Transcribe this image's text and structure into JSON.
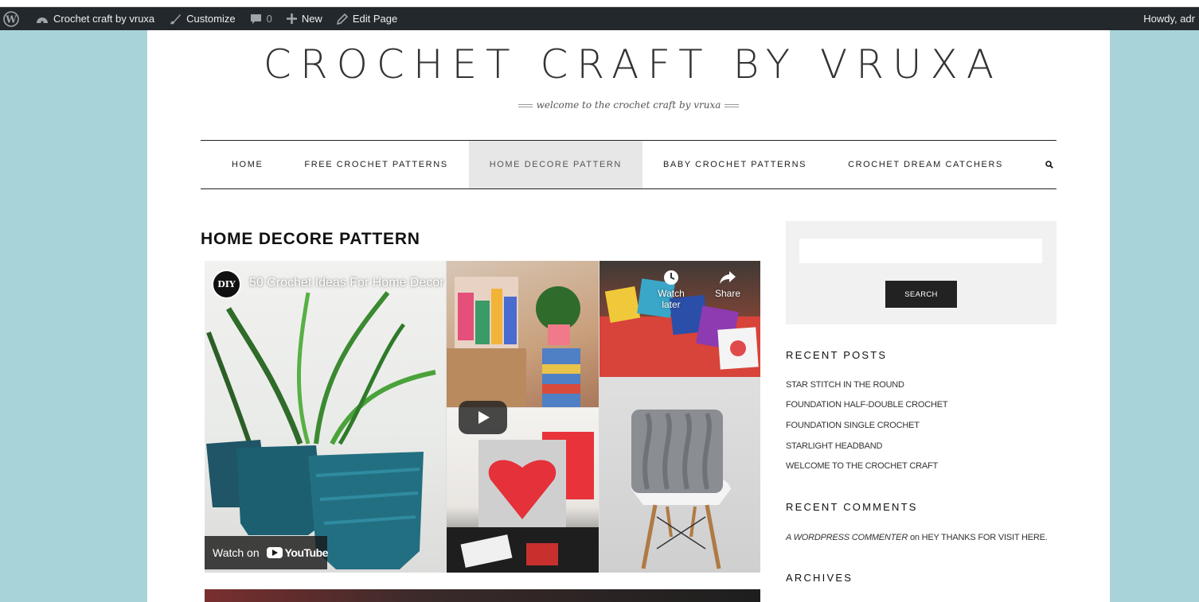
{
  "admin_bar": {
    "site_name": "Crochet craft by vruxa",
    "customize": "Customize",
    "comments_count": "0",
    "new": "New",
    "edit_page": "Edit Page",
    "howdy": "Howdy, adr"
  },
  "site": {
    "title": "CROCHET CRAFT BY VRUXA",
    "tagline": "welcome to the crochet craft by vruxa"
  },
  "nav": {
    "items": [
      {
        "label": "HOME"
      },
      {
        "label": "FREE CROCHET PATTERNS"
      },
      {
        "label": "HOME DECORE PATTERN"
      },
      {
        "label": "BABY CROCHET PATTERNS"
      },
      {
        "label": "CROCHET DREAM CATCHERS"
      }
    ],
    "active": "HOME DECORE PATTERN"
  },
  "main": {
    "heading": "HOME DECORE PATTERN",
    "video": {
      "channel_logo": "DIY",
      "title": "50 Crochet Ideas For Home Decor",
      "watch_later": "Watch later",
      "share": "Share",
      "watch_on": "Watch on",
      "youtube": "YouTube"
    }
  },
  "sidebar": {
    "search_button": "SEARCH",
    "recent_posts_title": "RECENT POSTS",
    "recent_posts": [
      "STAR STITCH IN THE ROUND",
      "FOUNDATION HALF-DOUBLE CROCHET",
      "FOUNDATION SINGLE CROCHET",
      "STARLIGHT HEADBAND",
      "WELCOME TO THE CROCHET CRAFT"
    ],
    "recent_comments_title": "RECENT COMMENTS",
    "comment": {
      "author": "A WORDPRESS COMMENTER",
      "on": "on",
      "post": "HEY THANKS FOR VISIT HERE."
    },
    "archives_title": "ARCHIVES"
  },
  "colors": {
    "background": "#a8d4d9",
    "admin_bar": "#23282d",
    "nav_active": "#e7e7e7",
    "button": "#222222"
  }
}
